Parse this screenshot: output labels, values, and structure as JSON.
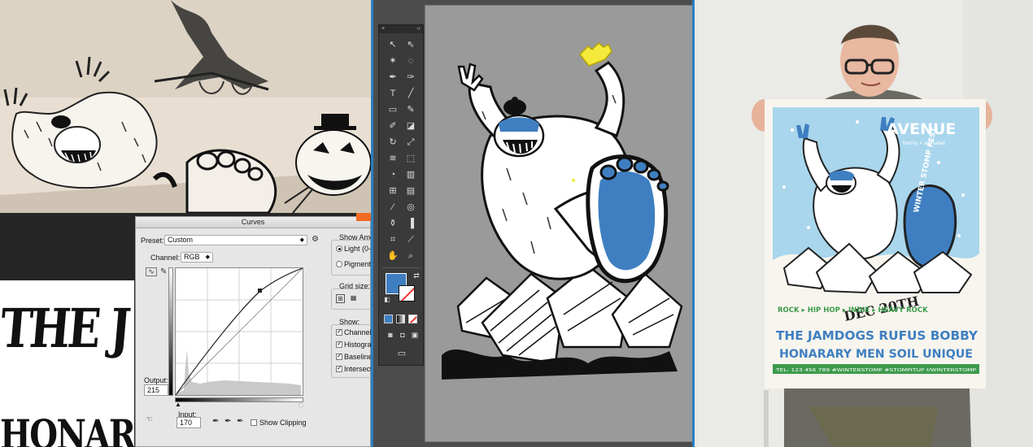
{
  "colors": {
    "accent_blue": "#3f7fc1",
    "arrow_orange": "#f26a21",
    "panel_border": "#2a7fc4",
    "poster_sky": "#a9d6ec",
    "poster_green": "#3c9b4c"
  },
  "left": {
    "lettering_line1": "THE J",
    "lettering_line2": "HONARARY MEN",
    "curves": {
      "title": "Curves",
      "preset_label": "Preset:",
      "preset_value": "Custom",
      "channel_label": "Channel:",
      "channel_value": "RGB",
      "show_amount_label": "Show Amo",
      "light_label": "Light (0-",
      "pigment_label": "Pigment/",
      "grid_size_label": "Grid size:",
      "show_label": "Show:",
      "show_items": [
        "Channel",
        "Histogra",
        "Baseline",
        "Intersect"
      ],
      "output_label": "Output:",
      "output_value": "215",
      "input_label": "Input:",
      "input_value": "170",
      "show_clipping_label": "Show Clipping",
      "icons": [
        "gear-icon",
        "curve-point-icon",
        "pencil-icon",
        "eyedropper-black-icon",
        "eyedropper-gray-icon",
        "eyedropper-white-icon",
        "hand-adjust-icon"
      ]
    }
  },
  "middle": {
    "toolbar": {
      "close_glyph": "×",
      "collapse_glyph": "‹‹",
      "tools": [
        "selection-tool",
        "direct-selection-tool",
        "magic-wand-tool",
        "lasso-tool",
        "pen-tool",
        "curvature-tool",
        "type-tool",
        "line-tool",
        "rectangle-tool",
        "paintbrush-tool",
        "shaper-tool",
        "eraser-tool",
        "rotate-tool",
        "scale-tool",
        "width-tool",
        "free-transform-tool",
        "shape-builder-tool",
        "perspective-tool",
        "mesh-tool",
        "gradient-tool",
        "eyedropper-tool",
        "blend-tool",
        "symbol-sprayer-tool",
        "column-graph-tool",
        "artboard-tool",
        "slice-tool",
        "hand-tool",
        "zoom-tool"
      ],
      "fill_color": "#3f7fc1"
    }
  },
  "right": {
    "poster": {
      "venue": "AVENUE",
      "venue_sub": "family • alphabet",
      "foot_text": "WINTER STOMP FEST",
      "date": "DEC 20TH",
      "genres": "ROCK ▸ HIP HOP ▸ INDIE ▸ HEAVY ROCK",
      "bands_line1": "THE JAMDOGS RUFUS BOBBY",
      "bands_line2": "HONARARY MEN SOIL UNIQUE",
      "footer": "TEL: 123 456 789   #WINTERSTOMP   #STOMPITUP   f/WINTERSTOMP"
    }
  }
}
